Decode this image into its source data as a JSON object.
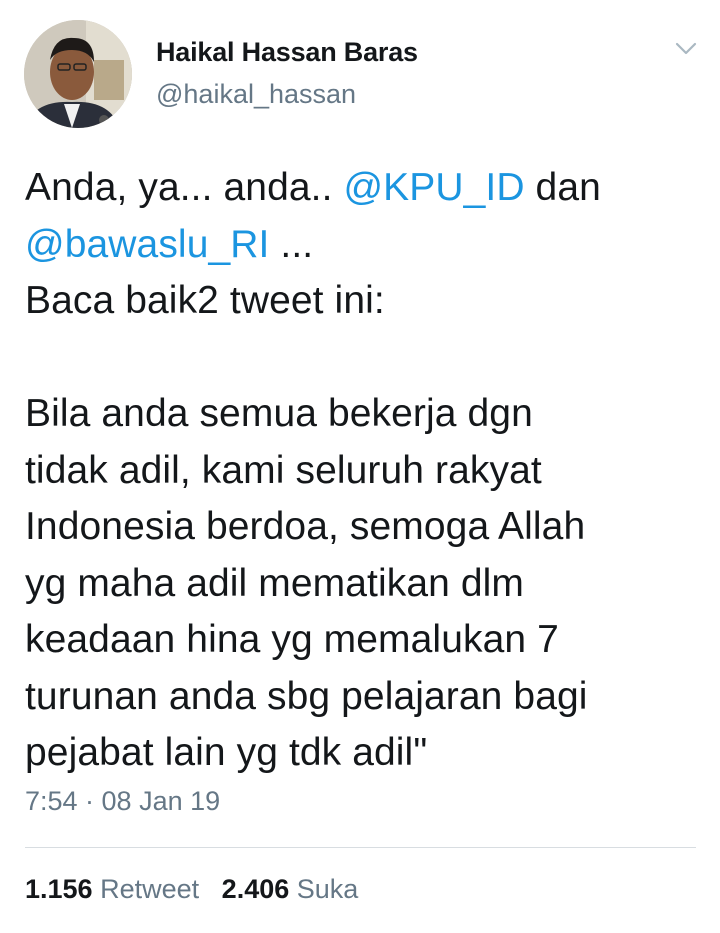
{
  "author": {
    "name": "Haikal Hassan Baras",
    "handle": "@haikal_hassan"
  },
  "tweet": {
    "line1_pre": "Anda, ya... anda.. ",
    "mention1": "@KPU_ID",
    "line1_post": " dan",
    "mention2": "@bawaslu_RI",
    "line2_post": " ...",
    "line3": "Baca baik2 tweet ini:",
    "line5": "Bila anda semua bekerja dgn",
    "line6": "tidak adil, kami seluruh rakyat",
    "line7": "Indonesia berdoa, semoga Allah",
    "line8": "yg maha adil mematikan dlm",
    "line9": "keadaan hina yg memalukan 7",
    "line10": "turunan anda sbg pelajaran bagi",
    "line11": "pejabat lain yg tdk adil\""
  },
  "timestamp": "7:54 · 08 Jan 19",
  "stats": {
    "retweets_count": "1.156",
    "retweets_label": "Retweet",
    "likes_count": "2.406",
    "likes_label": "Suka"
  },
  "colors": {
    "mention": "#1b95e0",
    "secondary_text": "#657786",
    "primary_text": "#14171a"
  },
  "icons": {
    "menu": "chevron-down-icon"
  }
}
